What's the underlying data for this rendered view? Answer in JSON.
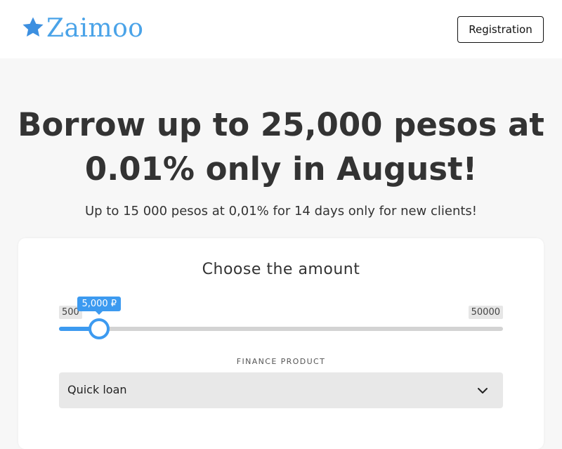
{
  "header": {
    "logo_text": "Zaimoo",
    "logo_icon": "star-icon",
    "logo_color": "#4aa3e8",
    "registration_label": "Registration"
  },
  "hero": {
    "title": "Borrow up to 25,000 pesos at 0.01% only in August!",
    "subtitle": "Up to 15 000 pesos at 0,01% for 14 days only for new clients!"
  },
  "calculator": {
    "title": "Choose the amount",
    "slider": {
      "min_label": "500",
      "max_label": "50000",
      "min": 500,
      "max": 50000,
      "value": 5000,
      "value_label": "5,000 ₽",
      "accent_color": "#3c9af0"
    },
    "finance_product": {
      "label": "FINANCE PRODUCT",
      "selected": "Quick loan",
      "icon": "chevron-down-icon"
    }
  }
}
